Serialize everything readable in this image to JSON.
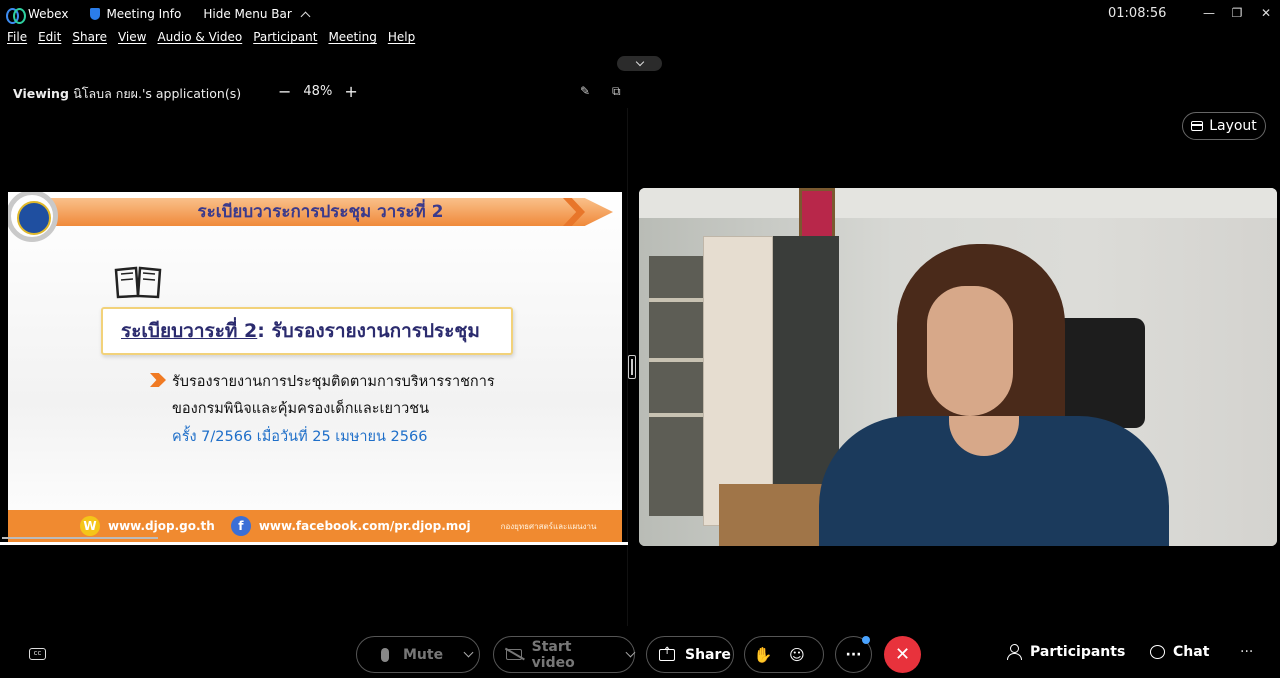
{
  "titlebar": {
    "app_name": "Webex",
    "meeting_info": "Meeting Info",
    "hide_menu_bar": "Hide Menu Bar",
    "clock": "01:08:56",
    "window_controls": {
      "minimize": "—",
      "restore": "❐",
      "close": "✕"
    }
  },
  "menu": [
    "File",
    "Edit",
    "Share",
    "View",
    "Audio & Video",
    "Participant",
    "Meeting",
    "Help"
  ],
  "viewing": {
    "prefix": "Viewing",
    "name": "นิโลบล กยผ.'s application(s)",
    "zoom_out": "−",
    "zoom_level": "48%",
    "zoom_in": "+"
  },
  "slide": {
    "header": "ระเบียบวาระการประชุม วาระที่ 2",
    "agenda_label": "ระเบียบวาระที่ 2",
    "agenda_title": " : รับรองรายงานการประชุม",
    "line1": "รับรองรายงานการประชุมติดตามการบริหารราชการ",
    "line2": "ของกรมพินิจและคุ้มครองเด็กและเยาวชน",
    "line3": "ครั้ง 7/2566 เมื่อวันที่ 25 เมษายน 2566",
    "footer_w": "W",
    "footer_web": "www.djop.go.th",
    "footer_f": "f",
    "footer_fb": "www.facebook.com/pr.djop.moj",
    "footer_small": "กองยุทธศาสตร์และแผนงาน"
  },
  "layout_button": "Layout",
  "controls": {
    "cc": "cc",
    "mute": "Mute",
    "start_video": "Start video",
    "share": "Share",
    "hand": "✋",
    "reactions": "☺",
    "more": "···",
    "end": "✕",
    "participants": "Participants",
    "chat": "Chat",
    "overflow": "···"
  },
  "colors": {
    "end_call": "#e8323c",
    "slide_accent": "#f08a30",
    "notify": "#4aa3ff"
  }
}
